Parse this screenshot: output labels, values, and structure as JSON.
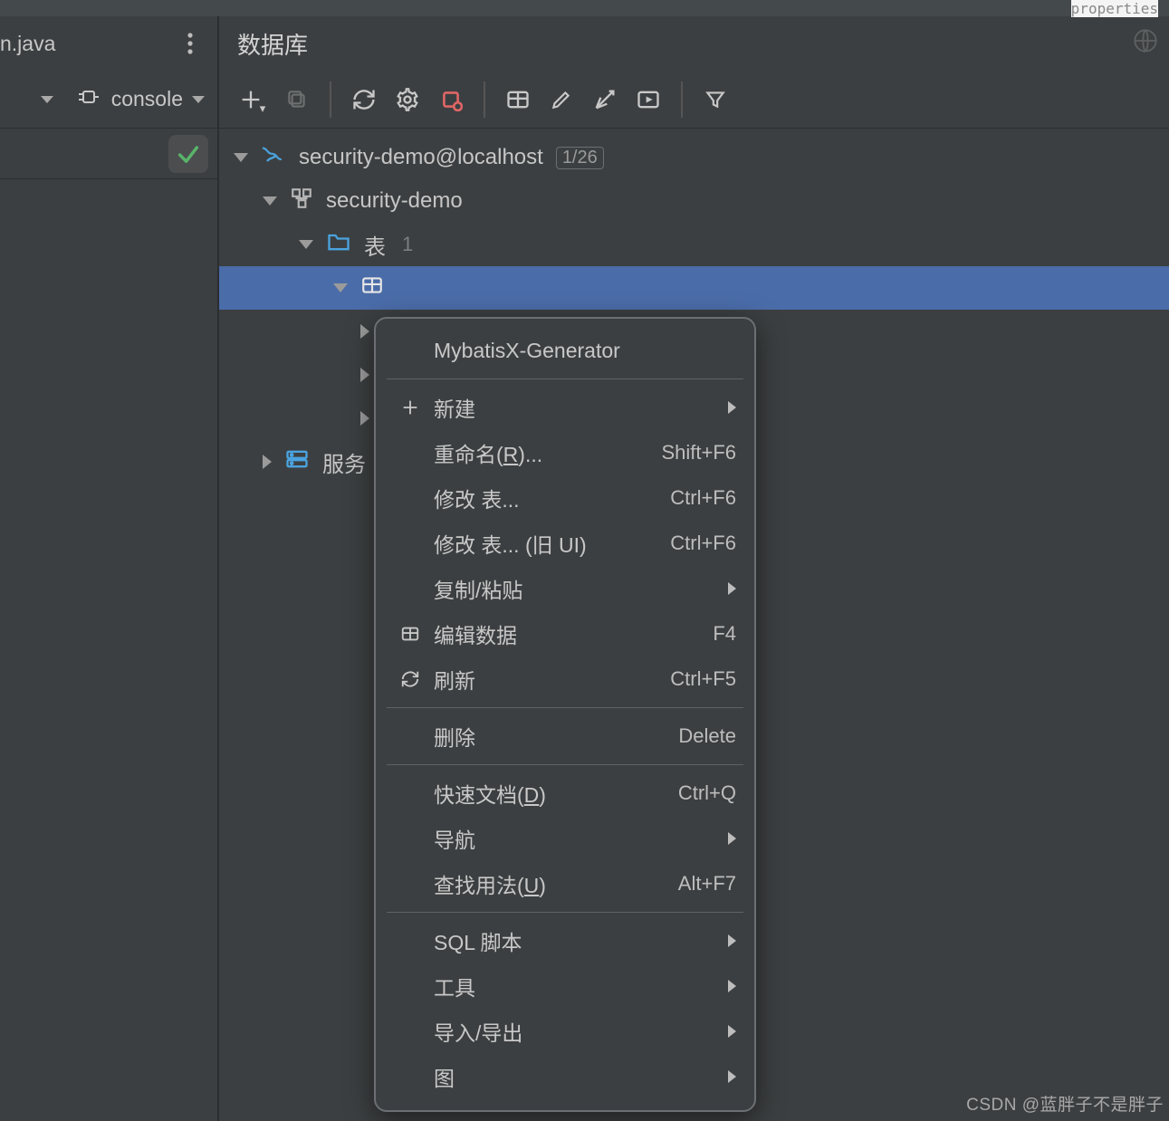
{
  "tiny_top_right": "properties",
  "tab": {
    "filename": "n.java"
  },
  "panel": {
    "title": "数据库"
  },
  "console": {
    "label": "console"
  },
  "tree": {
    "datasource": {
      "label": "security-demo@localhost",
      "badge": "1/26"
    },
    "schema": {
      "label": "security-demo"
    },
    "tables_group": {
      "label": "表",
      "count": "1"
    },
    "services_group": {
      "label": "服务"
    }
  },
  "context_menu": {
    "groups": [
      [
        {
          "label": "MybatisX-Generator",
          "icon": "",
          "shortcut": "",
          "submenu": false
        }
      ],
      [
        {
          "label": "新建",
          "icon": "plus",
          "shortcut": "",
          "submenu": true
        },
        {
          "label_html": "重命名(<u>R</u>)...",
          "icon": "",
          "shortcut": "Shift+F6",
          "submenu": false
        },
        {
          "label": "修改 表...",
          "icon": "",
          "shortcut": "Ctrl+F6",
          "submenu": false
        },
        {
          "label": "修改 表... (旧 UI)",
          "icon": "",
          "shortcut": "Ctrl+F6",
          "submenu": false
        },
        {
          "label": "复制/粘贴",
          "icon": "",
          "shortcut": "",
          "submenu": true
        },
        {
          "label": "编辑数据",
          "icon": "grid",
          "shortcut": "F4",
          "submenu": false
        },
        {
          "label": "刷新",
          "icon": "refresh",
          "shortcut": "Ctrl+F5",
          "submenu": false
        }
      ],
      [
        {
          "label": "删除",
          "icon": "",
          "shortcut": "Delete",
          "submenu": false
        }
      ],
      [
        {
          "label_html": "快速文档(<u>D</u>)",
          "icon": "",
          "shortcut": "Ctrl+Q",
          "submenu": false
        },
        {
          "label": "导航",
          "icon": "",
          "shortcut": "",
          "submenu": true
        },
        {
          "label_html": "查找用法(<u>U</u>)",
          "icon": "",
          "shortcut": "Alt+F7",
          "submenu": false
        }
      ],
      [
        {
          "label": "SQL 脚本",
          "icon": "",
          "shortcut": "",
          "submenu": true
        },
        {
          "label": "工具",
          "icon": "",
          "shortcut": "",
          "submenu": true
        },
        {
          "label": "导入/导出",
          "icon": "",
          "shortcut": "",
          "submenu": true
        },
        {
          "label": "图",
          "icon": "",
          "shortcut": "",
          "submenu": true
        }
      ]
    ]
  },
  "watermark": "CSDN @蓝胖子不是胖子"
}
